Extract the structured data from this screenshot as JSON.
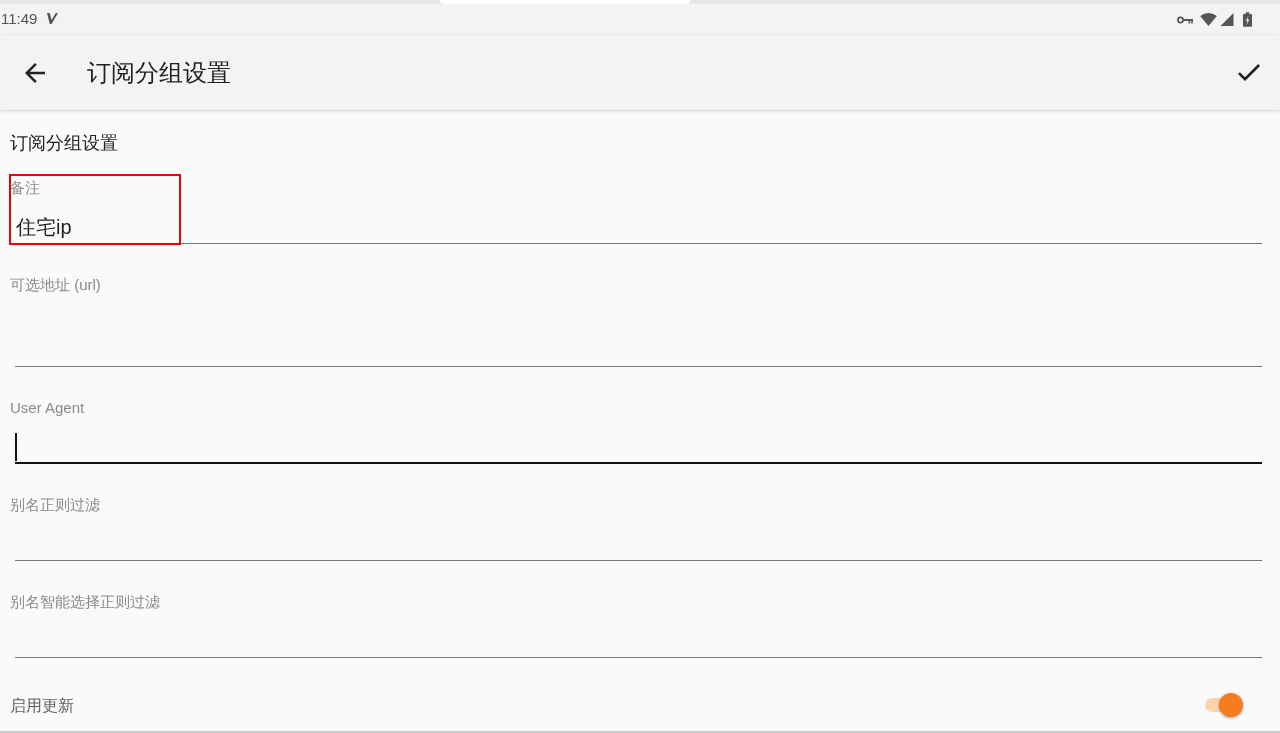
{
  "status_bar": {
    "time": "11:49"
  },
  "app_bar": {
    "title": "订阅分组设置"
  },
  "form": {
    "heading": "订阅分组设置",
    "fields": [
      {
        "label": "备注",
        "value": "住宅ip",
        "kind": "text",
        "focused": false,
        "highlighted": true
      },
      {
        "label": "可选地址 (url)",
        "kind": "multiline",
        "focused": false,
        "highlighted": false
      },
      {
        "label": "User Agent",
        "kind": "text",
        "focused": true,
        "highlighted": false
      },
      {
        "label": "别名正则过滤",
        "kind": "text",
        "focused": false,
        "highlighted": false
      },
      {
        "label": "别名智能选择正则过滤",
        "kind": "text",
        "focused": false,
        "highlighted": false
      }
    ],
    "toggle": {
      "label": "启用更新",
      "on": true
    }
  }
}
